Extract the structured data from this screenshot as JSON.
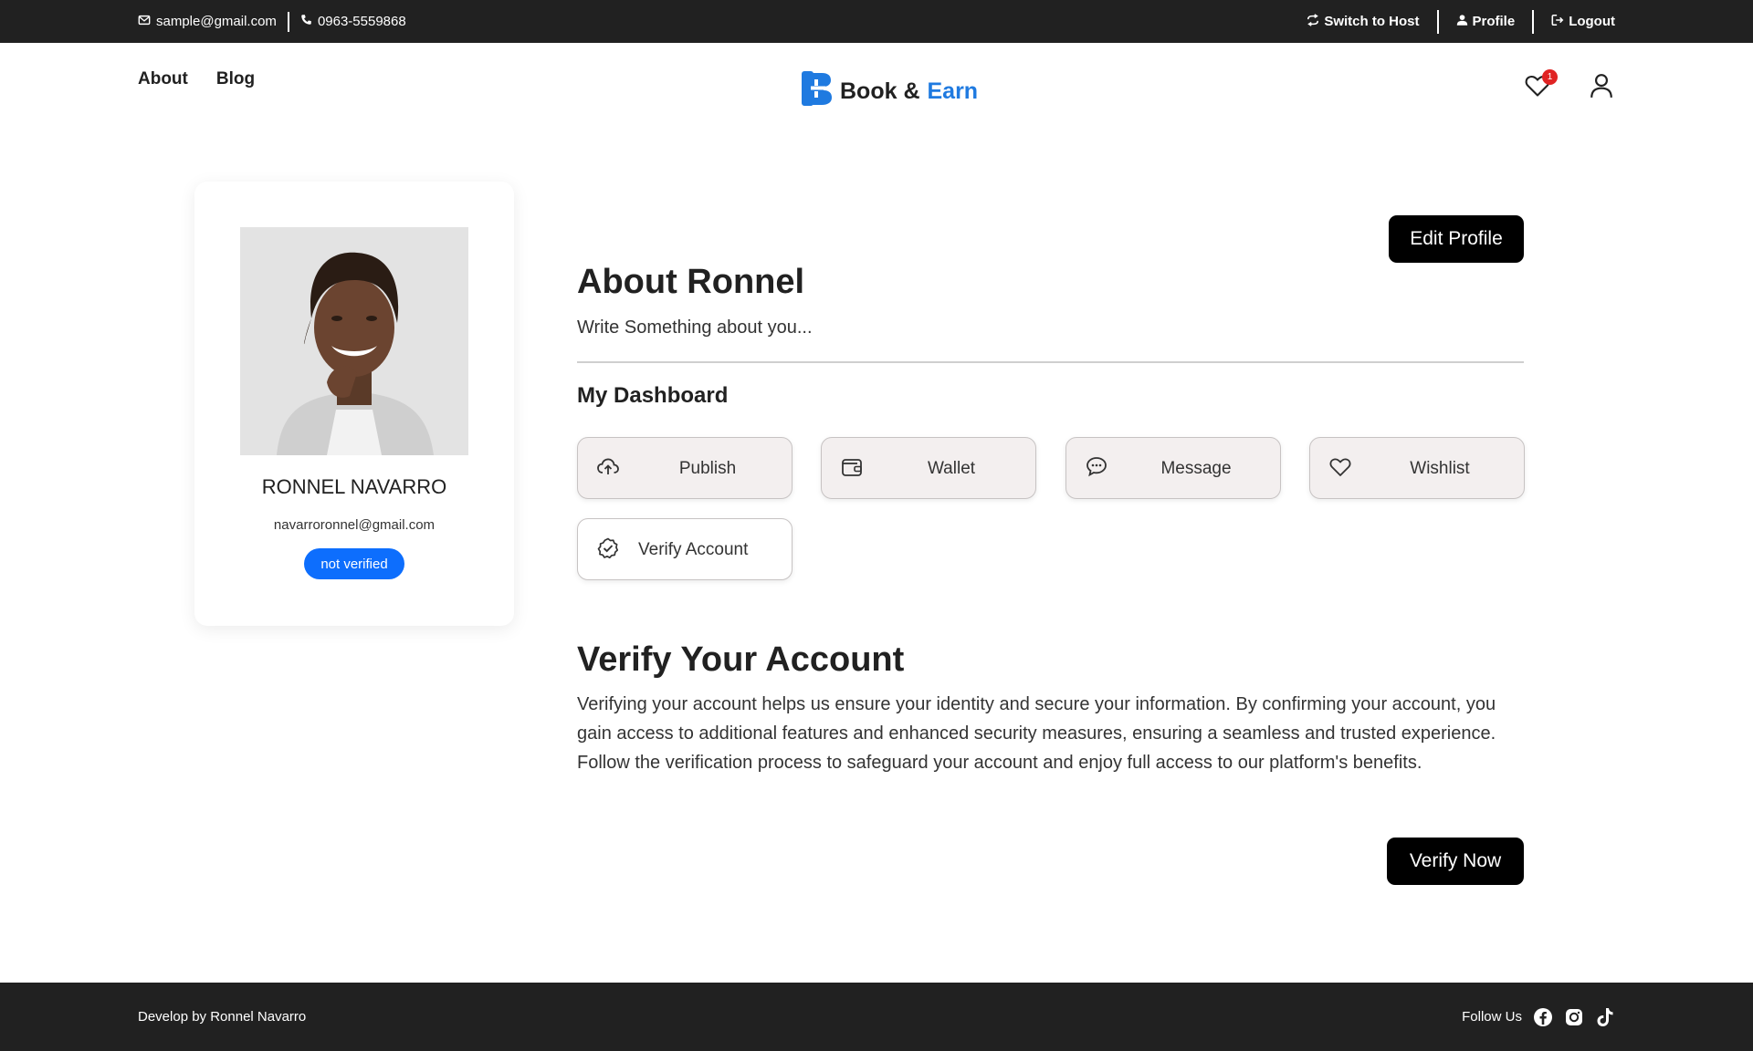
{
  "topbar": {
    "email": "sample@gmail.com",
    "phone": "0963-5559868",
    "switch_label": "Switch to Host",
    "profile_label": "Profile",
    "logout_label": "Logout"
  },
  "nav": {
    "links": [
      "About",
      "Blog"
    ],
    "brand_part1": "Book &",
    "brand_part2": "Earn",
    "wishlist_count": "1"
  },
  "profile": {
    "name": "RONNEL NAVARRO",
    "email": "navarroronnel@gmail.com",
    "status": "not verified"
  },
  "main": {
    "edit_button": "Edit Profile",
    "about_title": "About Ronnel",
    "about_text": "Write Something about you...",
    "dashboard_title": "My Dashboard",
    "dashboard_items": [
      {
        "label": "Publish",
        "icon": "cloud-upload-icon"
      },
      {
        "label": "Wallet",
        "icon": "wallet-icon"
      },
      {
        "label": "Message",
        "icon": "chat-icon"
      },
      {
        "label": "Wishlist",
        "icon": "heart-icon"
      },
      {
        "label": "Verify Account",
        "icon": "verified-badge-icon"
      }
    ],
    "verify_title": "Verify Your Account",
    "verify_text": "Verifying your account helps us ensure your identity and secure your information. By confirming your account, you gain access to additional features and enhanced security measures, ensuring a seamless and trusted experience. Follow the verification process to safeguard your account and enjoy full access to our platform's benefits.",
    "verify_button": "Verify Now"
  },
  "footer": {
    "credit": "Develop by Ronnel Navarro",
    "follow_label": "Follow Us",
    "social_icons": [
      "facebook-icon",
      "instagram-icon",
      "tiktok-icon"
    ]
  },
  "colors": {
    "dark": "#212121",
    "brand_blue": "#1f7ae0",
    "status_blue": "#0d6efd",
    "badge_red": "#e02424"
  }
}
